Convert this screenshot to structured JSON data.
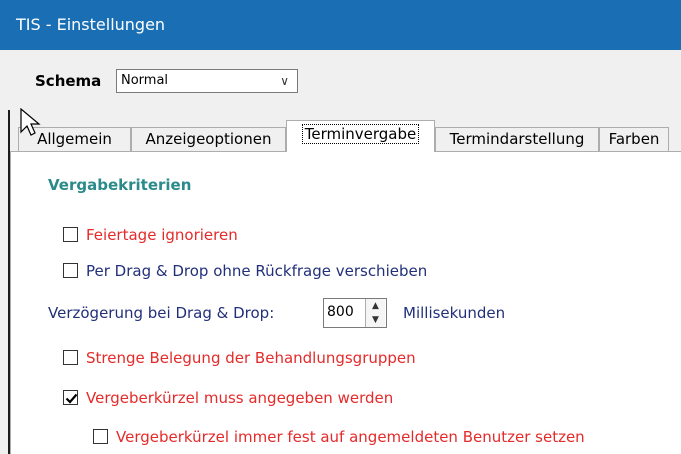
{
  "window": {
    "title": "TIS - Einstellungen"
  },
  "schema": {
    "label": "Schema",
    "selected": "Normal",
    "chevron_icon": "chevron-down-icon"
  },
  "tabs": [
    {
      "label": "Allgemein"
    },
    {
      "label": "Anzeigeoptionen"
    },
    {
      "label": "Terminvergabe",
      "active": true
    },
    {
      "label": "Termindarstellung"
    },
    {
      "label": "Farben"
    }
  ],
  "panel": {
    "section_title": "Vergabekriterien",
    "options": {
      "feiertage": {
        "label": "Feiertage ignorieren",
        "checked": false
      },
      "dragdrop": {
        "label": "Per Drag & Drop ohne Rückfrage verschieben",
        "checked": false
      },
      "strenge": {
        "label": "Strenge Belegung der Behandlungsgruppen",
        "checked": false
      },
      "vergeber": {
        "label": "Vergeberkürzel muss angegeben werden",
        "checked": true
      },
      "vergeber_fest": {
        "label": "Vergeberkürzel immer fest auf angemeldeten Benutzer setzen",
        "checked": false
      }
    },
    "delay": {
      "label": "Verzögerung bei Drag & Drop:",
      "value": "800",
      "unit": "Millisekunden"
    }
  },
  "colors": {
    "titlebar": "#1a6fb4",
    "section": "#2b8a8a",
    "red_text": "#e52a2a",
    "blue_text": "#22307a"
  }
}
